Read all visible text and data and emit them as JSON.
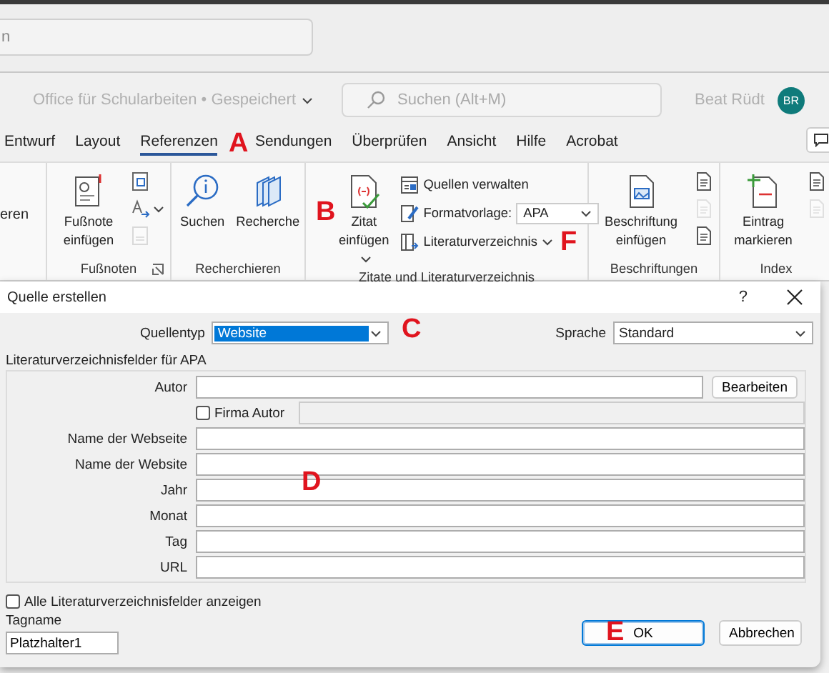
{
  "top_search": {
    "placeholder": "n"
  },
  "title_bar": {
    "document": "Office für Schularbeiten • Gespeichert",
    "search_placeholder": "Suchen (Alt+M)",
    "user": "Beat Rüdt",
    "avatar": "BR"
  },
  "tabs": [
    {
      "label": "Entwurf",
      "selected": false
    },
    {
      "label": "Layout",
      "selected": false
    },
    {
      "label": "Referenzen",
      "selected": true
    },
    {
      "label": "Sendungen",
      "selected": false
    },
    {
      "label": "Überprüfen",
      "selected": false
    },
    {
      "label": "Ansicht",
      "selected": false
    },
    {
      "label": "Hilfe",
      "selected": false
    },
    {
      "label": "Acrobat",
      "selected": false
    }
  ],
  "ribbon": {
    "groups": [
      {
        "commands": [
          {
            "kind": "text",
            "label": "eren"
          }
        ]
      },
      {
        "label": "Fußnoten",
        "launcher": true,
        "commands": [
          {
            "kind": "large",
            "label": "Fußnote einfügen"
          },
          {
            "kind": "stack",
            "items": [
              {
                "disabled": false
              },
              {
                "disabled": false,
                "dropdown": true
              },
              {
                "disabled": true
              }
            ]
          }
        ]
      },
      {
        "label": "Recherchieren",
        "commands": [
          {
            "kind": "large",
            "label": "Suchen"
          },
          {
            "kind": "large",
            "label": "Recherche"
          }
        ]
      },
      {
        "label": "Zitate und Literaturverzeichnis",
        "commands": [
          {
            "kind": "large",
            "label": "Zitat einfügen",
            "dropdown": true
          },
          {
            "kind": "column",
            "rows": [
              {
                "kind": "small",
                "label": "Quellen verwalten"
              },
              {
                "kind": "select",
                "label": "Formatvorlage:",
                "value": "APA"
              },
              {
                "kind": "small",
                "label": "Literaturverzeichnis",
                "dropdown": true
              }
            ]
          }
        ]
      },
      {
        "label": "Beschriftungen",
        "commands": [
          {
            "kind": "large",
            "label": "Beschriftung einfügen"
          },
          {
            "kind": "stack",
            "items": [
              {
                "disabled": false
              },
              {
                "disabled": true
              },
              {
                "disabled": false
              }
            ]
          }
        ]
      },
      {
        "label": "Index",
        "commands": [
          {
            "kind": "large",
            "label": "Eintrag markieren"
          },
          {
            "kind": "stack",
            "items": [
              {
                "disabled": false
              },
              {
                "disabled": true
              }
            ]
          }
        ]
      }
    ]
  },
  "dialog": {
    "title": "Quelle erstellen",
    "help": "?",
    "source_type": {
      "label": "Quellentyp",
      "value": "Website"
    },
    "language": {
      "label": "Sprache",
      "value": "Standard"
    },
    "fieldset": {
      "legend": "Literaturverzeichnisfelder für APA",
      "fields": [
        {
          "kind": "author",
          "label": "Autor",
          "button": "Bearbeiten",
          "corporate": {
            "label": "Firma Autor",
            "checked": false
          }
        },
        {
          "kind": "text",
          "label": "Name der Webseite"
        },
        {
          "kind": "text",
          "label": "Name der Website"
        },
        {
          "kind": "text",
          "label": "Jahr"
        },
        {
          "kind": "text",
          "label": "Monat"
        },
        {
          "kind": "text",
          "label": "Tag"
        },
        {
          "kind": "text",
          "label": "URL"
        }
      ]
    },
    "show_all": {
      "label": "Alle Literaturverzeichnisfelder anzeigen",
      "checked": false
    },
    "tag": {
      "label": "Tagname",
      "value": "Platzhalter1"
    },
    "buttons": [
      {
        "label": "OK",
        "default": true
      },
      {
        "label": "Abbrechen",
        "default": false
      }
    ]
  },
  "annotations": [
    {
      "letter": "A"
    },
    {
      "letter": "B"
    },
    {
      "letter": "C"
    },
    {
      "letter": "D"
    },
    {
      "letter": "E"
    },
    {
      "letter": "F"
    }
  ]
}
